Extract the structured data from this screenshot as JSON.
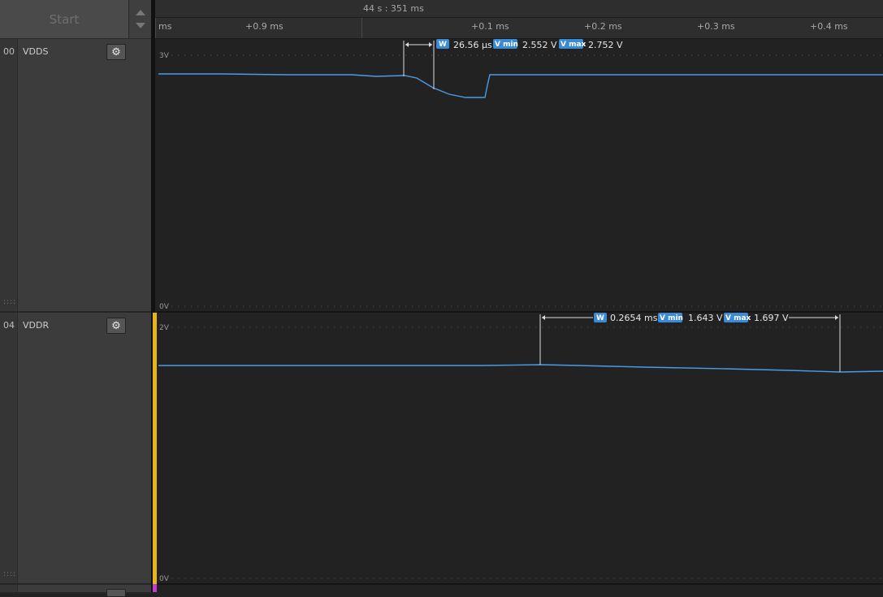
{
  "sidebar": {
    "start_label": "Start",
    "channels": [
      {
        "number": "00",
        "name": "VDDS",
        "settings_icon": "gear-icon"
      },
      {
        "number": "04",
        "name": "VDDR",
        "settings_icon": "gear-icon"
      }
    ]
  },
  "timeline": {
    "absolute_time": "44 s : 351 ms",
    "ticks": [
      "ms",
      "+0.9 ms",
      "+0.1 ms",
      "+0.2 ms",
      "+0.3 ms",
      "+0.4 ms"
    ]
  },
  "channels": [
    {
      "name": "VDDS",
      "y_top_label": "3V",
      "y_bottom_label": "0V",
      "measurement": {
        "w_tag": "W",
        "width": "26.56 µs",
        "vmin_tag": "V min",
        "vmin": "2.552 V",
        "vmax_tag": "V max",
        "vmax": "2.752 V"
      }
    },
    {
      "name": "VDDR",
      "y_top_label": "2V",
      "y_bottom_label": "0V",
      "measurement": {
        "w_tag": "W",
        "width": "0.2654 ms",
        "vmin_tag": "V min",
        "vmin": "1.643 V",
        "vmax_tag": "V max",
        "vmax": "1.697 V"
      }
    }
  ],
  "colors": {
    "trace": "#4a9be8",
    "accent_ch1": "#e8b518",
    "accent_ch2": "#c53ad0",
    "tag": "#3b8ad6"
  }
}
